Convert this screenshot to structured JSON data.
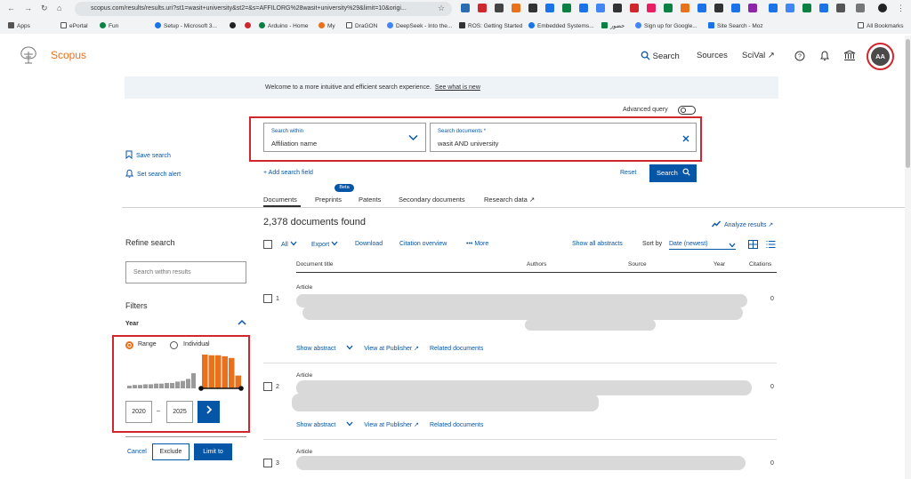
{
  "browser": {
    "url": "scopus.com/results/results.uri?st1=wasit+university&st2=&s=AFFILORG%28wasit+university%29&limit=10&origi...",
    "bookmarks": [
      "Apps",
      "ePortal",
      "Fun",
      "Setup - Microsoft 3...",
      "Arduino - Home",
      "My",
      "DraGON",
      "DeepSeek - Into the...",
      "ROS: Getting Started",
      "Embedded Systems...",
      "حضور",
      "Sign up for Google...",
      "Site Search - Moz",
      "All Bookmarks"
    ]
  },
  "header": {
    "brand": "Scopus",
    "search": "Search",
    "sources": "Sources",
    "scival": "SciVal ↗",
    "avatar": "AA"
  },
  "banner": {
    "text": "Welcome to a more intuitive and efficient search experience.",
    "link": "See what is new"
  },
  "search": {
    "advanced_query": "Advanced query",
    "within_label": "Search within",
    "within_value": "Affiliation name",
    "docs_label": "Search documents *",
    "docs_value": "wasit AND university",
    "add_field": "+ Add search field",
    "reset": "Reset",
    "search_button": "Search"
  },
  "side_links": {
    "save_search": "Save search",
    "set_alert": "Set search alert"
  },
  "tabs": [
    "Documents",
    "Preprints",
    "Patents",
    "Secondary documents",
    "Research data ↗"
  ],
  "beta": "Beta",
  "results": {
    "count": "2,378 documents found",
    "analyze": "Analyze results ↗",
    "toolbar": {
      "all": "All",
      "export": "Export",
      "download": "Download",
      "citation_overview": "Citation overview",
      "more": "More",
      "show_abstracts": "Show all abstracts",
      "sort_by": "Sort by",
      "sort_value": "Date (newest)"
    },
    "columns": [
      "Document title",
      "Authors",
      "Source",
      "Year",
      "Citations"
    ],
    "rows": [
      {
        "num": "1",
        "type": "Article",
        "citations": "0"
      },
      {
        "num": "2",
        "type": "Article",
        "citations": "0"
      },
      {
        "num": "3",
        "type": "Article",
        "citations": "0"
      }
    ],
    "row_links": {
      "abstract": "Show abstract",
      "publisher": "View at Publisher ↗",
      "related": "Related documents"
    }
  },
  "refine": {
    "title": "Refine search",
    "search_placeholder": "Search within results",
    "filters": "Filters",
    "year": "Year",
    "range": "Range",
    "individual": "Individual",
    "year_from": "2020",
    "year_to": "2025",
    "cancel": "Cancel",
    "exclude": "Exclude",
    "limit": "Limit to"
  },
  "year_histogram": {
    "gray_levels": [
      0.08,
      0.1,
      0.1,
      0.12,
      0.12,
      0.14,
      0.14,
      0.16,
      0.16,
      0.2,
      0.22,
      0.28,
      0.45
    ],
    "orange_levels": [
      1.0,
      0.98,
      0.98,
      0.95,
      0.9,
      0.38
    ]
  },
  "colors": {
    "accent": "#e9711c",
    "link": "#0656a8",
    "highlight": "#d0262d"
  }
}
